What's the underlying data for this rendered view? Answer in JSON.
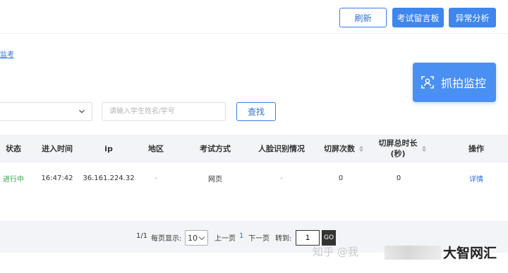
{
  "toolbar": {
    "refresh_label": "刷新",
    "message_board_label": "考试留言板",
    "anomaly_label": "异常分析"
  },
  "breadcrumb": {
    "link_text": "监考"
  },
  "capture": {
    "label": "抓拍监控",
    "icon": "camera-frame-icon"
  },
  "filters": {
    "select_value": "",
    "search_placeholder": "请输入学生姓名/学号",
    "search_button": "查找"
  },
  "table": {
    "headers": {
      "status": "状态",
      "enter_time": "进入时间",
      "ip": "ip",
      "region": "地区",
      "exam_mode": "考试方式",
      "face_recognition": "人脸识别情况",
      "switch_count": "切屏次数",
      "switch_total_line1": "切屏总时长",
      "switch_total_line2": "(秒)",
      "actions": "操作"
    },
    "rows": [
      {
        "status": "进行中",
        "enter_time": "16:47:42",
        "ip": "36.161.224.32",
        "region": "-",
        "exam_mode": "网页",
        "face_recognition": "-",
        "switch_count": "0",
        "switch_total": "0",
        "action": "详情"
      }
    ]
  },
  "pagination": {
    "page_info": "1/1",
    "per_page_label": "每页显示:",
    "per_page_value": "10",
    "prev_label": "上一页",
    "current_page": "1",
    "next_label": "下一页",
    "goto_label": "转到:",
    "goto_value": "1",
    "go_label": "GO"
  },
  "watermark": {
    "text": "知乎 @我",
    "brand": "大智网汇"
  },
  "colors": {
    "accent": "#3f86ee",
    "link": "#2e6fd6",
    "status_running": "#3aa14a",
    "header_bg": "#f2f4f7"
  }
}
